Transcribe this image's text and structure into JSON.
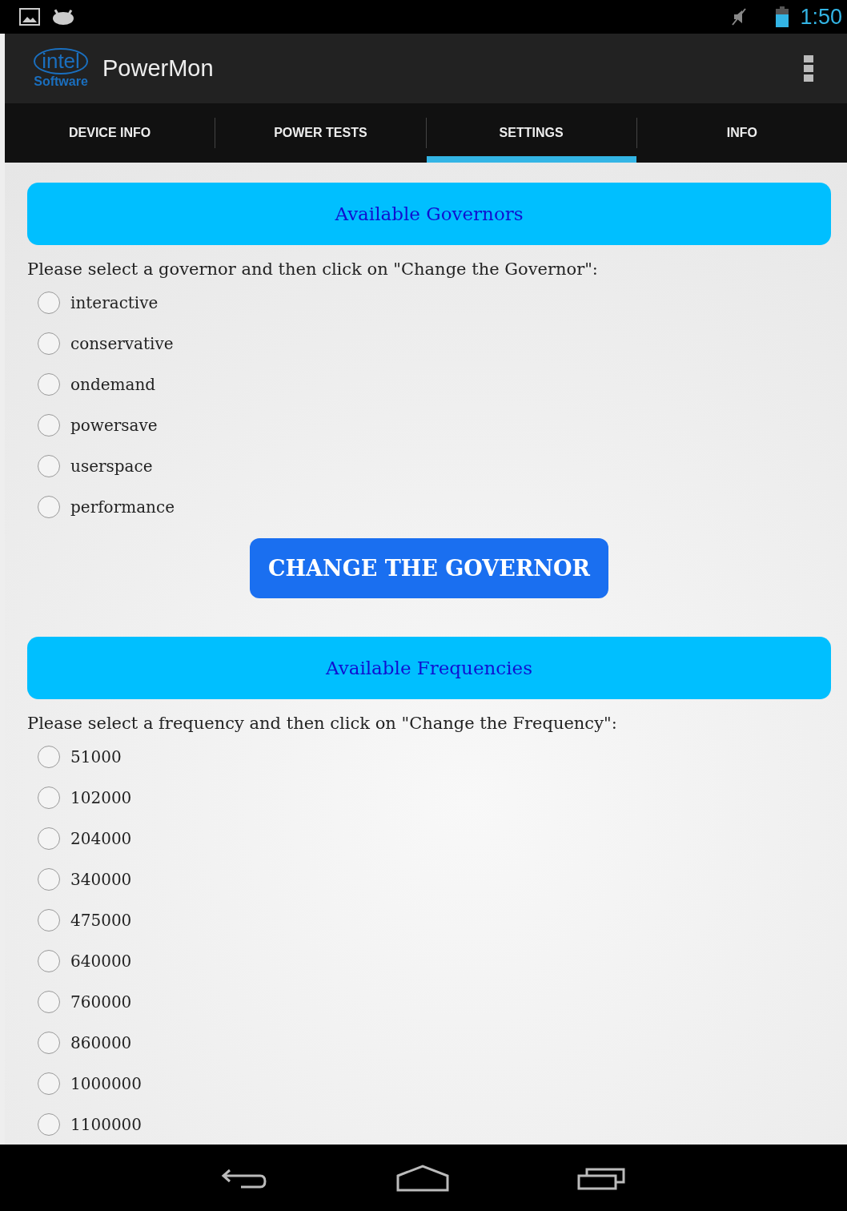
{
  "status_bar": {
    "time": "1:50"
  },
  "app_bar": {
    "logo_top": "intel",
    "logo_bottom": "Software",
    "title": "PowerMon"
  },
  "tabs": [
    {
      "label": "DEVICE INFO",
      "selected": false
    },
    {
      "label": "POWER TESTS",
      "selected": false
    },
    {
      "label": "SETTINGS",
      "selected": true
    },
    {
      "label": "INFO",
      "selected": false
    }
  ],
  "governors": {
    "heading": "Available Governors",
    "prompt": "Please select a governor and then click on \"Change the Governor\":",
    "options": [
      {
        "label": "interactive",
        "selected": false
      },
      {
        "label": "conservative",
        "selected": false
      },
      {
        "label": "ondemand",
        "selected": false
      },
      {
        "label": "powersave",
        "selected": false
      },
      {
        "label": "userspace",
        "selected": false
      },
      {
        "label": "performance",
        "selected": false
      }
    ],
    "button": "CHANGE THE GOVERNOR"
  },
  "frequencies": {
    "heading": "Available Frequencies",
    "prompt": "Please select a frequency and then click on \"Change the Frequency\":",
    "options": [
      {
        "label": "51000",
        "selected": false
      },
      {
        "label": "102000",
        "selected": false
      },
      {
        "label": "204000",
        "selected": false
      },
      {
        "label": "340000",
        "selected": false
      },
      {
        "label": "475000",
        "selected": false
      },
      {
        "label": "640000",
        "selected": false
      },
      {
        "label": "760000",
        "selected": false
      },
      {
        "label": "860000",
        "selected": false
      },
      {
        "label": "1000000",
        "selected": false
      },
      {
        "label": "1100000",
        "selected": false
      }
    ]
  }
}
